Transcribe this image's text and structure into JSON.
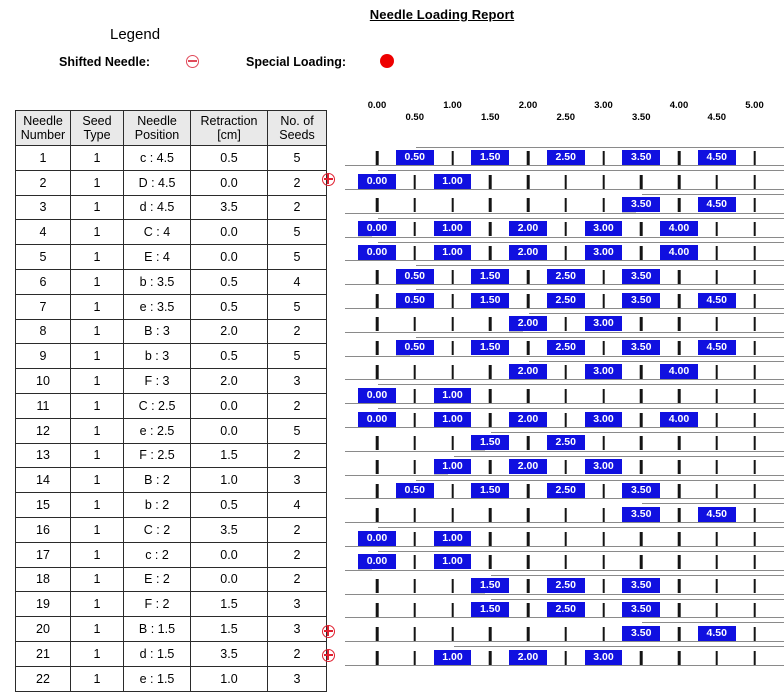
{
  "title": "Needle Loading Report",
  "legend": {
    "heading": "Legend",
    "shifted_label": "Shifted Needle:",
    "shifted_icon": "circle-minus-icon",
    "special_label": "Special Loading:",
    "special_icon": "filled-circle-icon"
  },
  "colors": {
    "seed_box": "#1010e0",
    "special_loading": "#ee0000",
    "shifted_needle": "#e02030",
    "header_bg": "#e9e9e9",
    "grid_line": "#8a8a8a"
  },
  "table": {
    "columns": [
      {
        "line1": "Needle",
        "line2": "Number"
      },
      {
        "line1": "Seed",
        "line2": "Type"
      },
      {
        "line1": "Needle",
        "line2": "Position"
      },
      {
        "line1": "Retraction",
        "line2": "[cm]"
      },
      {
        "line1": "No. of",
        "line2": "Seeds"
      }
    ],
    "rows": [
      {
        "number": "1",
        "seed_type": "1",
        "position": "c : 4.5",
        "retraction": "0.5",
        "seeds": "5",
        "shifted": false
      },
      {
        "number": "2",
        "seed_type": "1",
        "position": "D : 4.5",
        "retraction": "0.0",
        "seeds": "2",
        "shifted": true
      },
      {
        "number": "3",
        "seed_type": "1",
        "position": "d : 4.5",
        "retraction": "3.5",
        "seeds": "2",
        "shifted": false
      },
      {
        "number": "4",
        "seed_type": "1",
        "position": "C : 4",
        "retraction": "0.0",
        "seeds": "5",
        "shifted": false
      },
      {
        "number": "5",
        "seed_type": "1",
        "position": "E : 4",
        "retraction": "0.0",
        "seeds": "5",
        "shifted": false
      },
      {
        "number": "6",
        "seed_type": "1",
        "position": "b : 3.5",
        "retraction": "0.5",
        "seeds": "4",
        "shifted": false
      },
      {
        "number": "7",
        "seed_type": "1",
        "position": "e : 3.5",
        "retraction": "0.5",
        "seeds": "5",
        "shifted": false
      },
      {
        "number": "8",
        "seed_type": "1",
        "position": "B : 3",
        "retraction": "2.0",
        "seeds": "2",
        "shifted": false
      },
      {
        "number": "9",
        "seed_type": "1",
        "position": "b : 3",
        "retraction": "0.5",
        "seeds": "5",
        "shifted": false
      },
      {
        "number": "10",
        "seed_type": "1",
        "position": "F : 3",
        "retraction": "2.0",
        "seeds": "3",
        "shifted": false
      },
      {
        "number": "11",
        "seed_type": "1",
        "position": "C : 2.5",
        "retraction": "0.0",
        "seeds": "2",
        "shifted": false
      },
      {
        "number": "12",
        "seed_type": "1",
        "position": "e : 2.5",
        "retraction": "0.0",
        "seeds": "5",
        "shifted": false
      },
      {
        "number": "13",
        "seed_type": "1",
        "position": "F : 2.5",
        "retraction": "1.5",
        "seeds": "2",
        "shifted": false
      },
      {
        "number": "14",
        "seed_type": "1",
        "position": "B : 2",
        "retraction": "1.0",
        "seeds": "3",
        "shifted": false
      },
      {
        "number": "15",
        "seed_type": "1",
        "position": "b : 2",
        "retraction": "0.5",
        "seeds": "4",
        "shifted": false
      },
      {
        "number": "16",
        "seed_type": "1",
        "position": "C : 2",
        "retraction": "3.5",
        "seeds": "2",
        "shifted": false
      },
      {
        "number": "17",
        "seed_type": "1",
        "position": "c : 2",
        "retraction": "0.0",
        "seeds": "2",
        "shifted": false
      },
      {
        "number": "18",
        "seed_type": "1",
        "position": "E : 2",
        "retraction": "0.0",
        "seeds": "2",
        "shifted": false
      },
      {
        "number": "19",
        "seed_type": "1",
        "position": "F : 2",
        "retraction": "1.5",
        "seeds": "3",
        "shifted": false
      },
      {
        "number": "20",
        "seed_type": "1",
        "position": "B : 1.5",
        "retraction": "1.5",
        "seeds": "3",
        "shifted": false
      },
      {
        "number": "21",
        "seed_type": "1",
        "position": "d : 1.5",
        "retraction": "3.5",
        "seeds": "2",
        "shifted": true
      },
      {
        "number": "22",
        "seed_type": "1",
        "position": "e : 1.5",
        "retraction": "1.0",
        "seeds": "3",
        "shifted": true
      }
    ]
  },
  "chart_data": {
    "type": "table",
    "title": "Needle Loading Report",
    "xlabel": "",
    "ylabel": "",
    "xlim": [
      0,
      5
    ],
    "axis_ticks": [
      "0.00",
      "0.50",
      "1.00",
      "1.50",
      "2.00",
      "2.50",
      "3.00",
      "3.50",
      "4.00",
      "4.50",
      "5.00"
    ],
    "axis_tick_values": [
      0,
      0.5,
      1.0,
      1.5,
      2.0,
      2.5,
      3.0,
      3.5,
      4.0,
      4.5,
      5.0
    ],
    "tick_interval": 0.5,
    "grid": false,
    "legend_position": "top",
    "box_width_units": 0.5,
    "rows": [
      {
        "needle": 1,
        "ramp_start": 0.25,
        "seed_positions": [
          0.5,
          1.5,
          2.5,
          3.5,
          4.5
        ],
        "seed_labels": [
          "0.50",
          "1.50",
          "2.50",
          "3.50",
          "4.50"
        ]
      },
      {
        "needle": 2,
        "ramp_start": -0.25,
        "seed_positions": [
          0.0,
          1.0
        ],
        "seed_labels": [
          "0.00",
          "1.00"
        ]
      },
      {
        "needle": 3,
        "ramp_start": 3.25,
        "seed_positions": [
          3.5,
          4.5
        ],
        "seed_labels": [
          "3.50",
          "4.50"
        ]
      },
      {
        "needle": 4,
        "ramp_start": -0.25,
        "seed_positions": [
          0.0,
          1.0,
          2.0,
          3.0,
          4.0
        ],
        "seed_labels": [
          "0.00",
          "1.00",
          "2.00",
          "3.00",
          "4.00"
        ]
      },
      {
        "needle": 5,
        "ramp_start": -0.25,
        "seed_positions": [
          0.0,
          1.0,
          2.0,
          3.0,
          4.0
        ],
        "seed_labels": [
          "0.00",
          "1.00",
          "2.00",
          "3.00",
          "4.00"
        ]
      },
      {
        "needle": 6,
        "ramp_start": 0.25,
        "seed_positions": [
          0.5,
          1.5,
          2.5,
          3.5
        ],
        "seed_labels": [
          "0.50",
          "1.50",
          "2.50",
          "3.50"
        ]
      },
      {
        "needle": 7,
        "ramp_start": 0.25,
        "seed_positions": [
          0.5,
          1.5,
          2.5,
          3.5,
          4.5
        ],
        "seed_labels": [
          "0.50",
          "1.50",
          "2.50",
          "3.50",
          "4.50"
        ]
      },
      {
        "needle": 8,
        "ramp_start": 1.75,
        "seed_positions": [
          2.0,
          3.0
        ],
        "seed_labels": [
          "2.00",
          "3.00"
        ]
      },
      {
        "needle": 9,
        "ramp_start": 0.25,
        "seed_positions": [
          0.5,
          1.5,
          2.5,
          3.5,
          4.5
        ],
        "seed_labels": [
          "0.50",
          "1.50",
          "2.50",
          "3.50",
          "4.50"
        ]
      },
      {
        "needle": 10,
        "ramp_start": 1.75,
        "seed_positions": [
          2.0,
          3.0,
          4.0
        ],
        "seed_labels": [
          "2.00",
          "3.00",
          "4.00"
        ]
      },
      {
        "needle": 11,
        "ramp_start": -0.25,
        "seed_positions": [
          0.0,
          1.0
        ],
        "seed_labels": [
          "0.00",
          "1.00"
        ]
      },
      {
        "needle": 12,
        "ramp_start": -0.25,
        "seed_positions": [
          0.0,
          1.0,
          2.0,
          3.0,
          4.0
        ],
        "seed_labels": [
          "0.00",
          "1.00",
          "2.00",
          "3.00",
          "4.00"
        ]
      },
      {
        "needle": 13,
        "ramp_start": 1.25,
        "seed_positions": [
          1.5,
          2.5
        ],
        "seed_labels": [
          "1.50",
          "2.50"
        ]
      },
      {
        "needle": 14,
        "ramp_start": 0.75,
        "seed_positions": [
          1.0,
          2.0,
          3.0
        ],
        "seed_labels": [
          "1.00",
          "2.00",
          "3.00"
        ]
      },
      {
        "needle": 15,
        "ramp_start": 0.25,
        "seed_positions": [
          0.5,
          1.5,
          2.5,
          3.5
        ],
        "seed_labels": [
          "0.50",
          "1.50",
          "2.50",
          "3.50"
        ]
      },
      {
        "needle": 16,
        "ramp_start": 3.25,
        "seed_positions": [
          3.5,
          4.5
        ],
        "seed_labels": [
          "3.50",
          "4.50"
        ]
      },
      {
        "needle": 17,
        "ramp_start": -0.25,
        "seed_positions": [
          0.0,
          1.0
        ],
        "seed_labels": [
          "0.00",
          "1.00"
        ]
      },
      {
        "needle": 18,
        "ramp_start": -0.25,
        "seed_positions": [
          0.0,
          1.0
        ],
        "seed_labels": [
          "0.00",
          "1.00"
        ]
      },
      {
        "needle": 19,
        "ramp_start": 1.25,
        "seed_positions": [
          1.5,
          2.5,
          3.5
        ],
        "seed_labels": [
          "1.50",
          "2.50",
          "3.50"
        ]
      },
      {
        "needle": 20,
        "ramp_start": 1.25,
        "seed_positions": [
          1.5,
          2.5,
          3.5
        ],
        "seed_labels": [
          "1.50",
          "2.50",
          "3.50"
        ]
      },
      {
        "needle": 21,
        "ramp_start": 3.25,
        "seed_positions": [
          3.5,
          4.5
        ],
        "seed_labels": [
          "3.50",
          "4.50"
        ]
      },
      {
        "needle": 22,
        "ramp_start": 0.75,
        "seed_positions": [
          1.0,
          2.0,
          3.0
        ],
        "seed_labels": [
          "1.00",
          "2.00",
          "3.00"
        ]
      }
    ]
  }
}
